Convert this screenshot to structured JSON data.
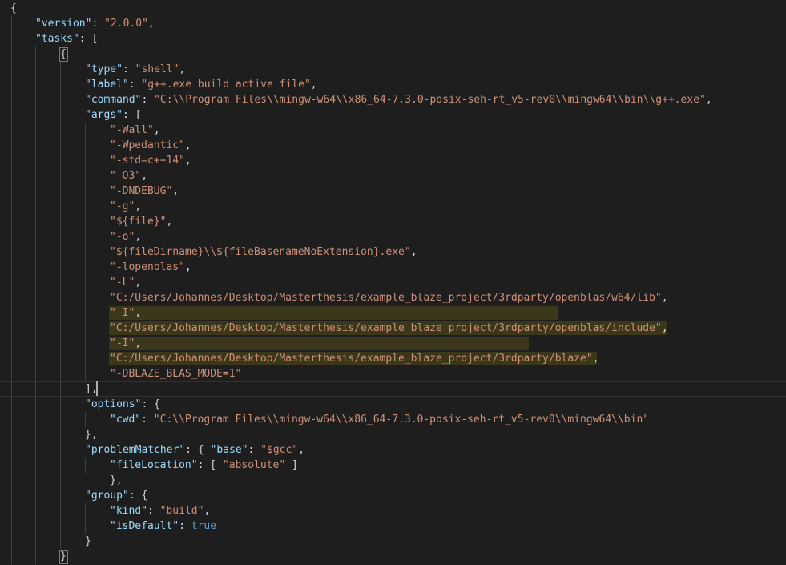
{
  "editor": {
    "language": "json",
    "file_lines": [
      [
        {
          "t": "p",
          "v": "{"
        }
      ],
      [
        {
          "t": "k",
          "v": "\"version\""
        },
        {
          "t": "p",
          "v": ": "
        },
        {
          "t": "s",
          "v": "\"2.0.0\""
        },
        {
          "t": "p",
          "v": ","
        }
      ],
      [
        {
          "t": "k",
          "v": "\"tasks\""
        },
        {
          "t": "p",
          "v": ": ["
        }
      ],
      [
        {
          "t": "p",
          "v": "{"
        }
      ],
      [
        {
          "t": "k",
          "v": "\"type\""
        },
        {
          "t": "p",
          "v": ": "
        },
        {
          "t": "s",
          "v": "\"shell\""
        },
        {
          "t": "p",
          "v": ","
        }
      ],
      [
        {
          "t": "k",
          "v": "\"label\""
        },
        {
          "t": "p",
          "v": ": "
        },
        {
          "t": "s",
          "v": "\"g++.exe build active file\""
        },
        {
          "t": "p",
          "v": ","
        }
      ],
      [
        {
          "t": "k",
          "v": "\"command\""
        },
        {
          "t": "p",
          "v": ": "
        },
        {
          "t": "s",
          "v": "\"C:\\\\Program Files\\\\mingw-w64\\\\x86_64-7.3.0-posix-seh-rt_v5-rev0\\\\mingw64\\\\bin\\\\g++.exe\""
        },
        {
          "t": "p",
          "v": ","
        }
      ],
      [
        {
          "t": "k",
          "v": "\"args\""
        },
        {
          "t": "p",
          "v": ": ["
        }
      ],
      [
        {
          "t": "s",
          "v": "\"-Wall\""
        },
        {
          "t": "p",
          "v": ","
        }
      ],
      [
        {
          "t": "s",
          "v": "\"-Wpedantic\""
        },
        {
          "t": "p",
          "v": ","
        }
      ],
      [
        {
          "t": "s",
          "v": "\"-std=c++14\""
        },
        {
          "t": "p",
          "v": ","
        }
      ],
      [
        {
          "t": "s",
          "v": "\"-O3\""
        },
        {
          "t": "p",
          "v": ","
        }
      ],
      [
        {
          "t": "s",
          "v": "\"-DNDEBUG\""
        },
        {
          "t": "p",
          "v": ","
        }
      ],
      [
        {
          "t": "s",
          "v": "\"-g\""
        },
        {
          "t": "p",
          "v": ","
        }
      ],
      [
        {
          "t": "s",
          "v": "\"${file}\""
        },
        {
          "t": "p",
          "v": ","
        }
      ],
      [
        {
          "t": "s",
          "v": "\"-o\""
        },
        {
          "t": "p",
          "v": ","
        }
      ],
      [
        {
          "t": "s",
          "v": "\"${fileDirname}\\\\${fileBasenameNoExtension}.exe\""
        },
        {
          "t": "p",
          "v": ","
        }
      ],
      [
        {
          "t": "s",
          "v": "\"-lopenblas\""
        },
        {
          "t": "p",
          "v": ","
        }
      ],
      [
        {
          "t": "s",
          "v": "\"-L\""
        },
        {
          "t": "p",
          "v": ","
        }
      ],
      [
        {
          "t": "s",
          "v": "\"C:/Users/Johannes/Desktop/Masterthesis/example_blaze_project/3rdparty/openblas/w64/lib\""
        },
        {
          "t": "p",
          "v": ","
        }
      ],
      [
        {
          "t": "s",
          "v": "\"-I\""
        },
        {
          "t": "p",
          "v": ","
        }
      ],
      [
        {
          "t": "s",
          "v": "\"C:/Users/Johannes/Desktop/Masterthesis/example_blaze_project/3rdparty/openblas/include\""
        },
        {
          "t": "p",
          "v": ","
        }
      ],
      [
        {
          "t": "s",
          "v": "\"-I\""
        },
        {
          "t": "p",
          "v": ","
        }
      ],
      [
        {
          "t": "s",
          "v": "\"C:/Users/Johannes/Desktop/Masterthesis/example_blaze_project/3rdparty/blaze\""
        },
        {
          "t": "p",
          "v": ","
        }
      ],
      [
        {
          "t": "s",
          "v": "\"-DBLAZE_BLAS_MODE=1\""
        }
      ],
      [
        {
          "t": "p",
          "v": "],"
        }
      ],
      [
        {
          "t": "k",
          "v": "\"options\""
        },
        {
          "t": "p",
          "v": ": {"
        }
      ],
      [
        {
          "t": "k",
          "v": "\"cwd\""
        },
        {
          "t": "p",
          "v": ": "
        },
        {
          "t": "s",
          "v": "\"C:\\\\Program Files\\\\mingw-w64\\\\x86_64-7.3.0-posix-seh-rt_v5-rev0\\\\mingw64\\\\bin\""
        }
      ],
      [
        {
          "t": "p",
          "v": "},"
        }
      ],
      [
        {
          "t": "k",
          "v": "\"problemMatcher\""
        },
        {
          "t": "p",
          "v": ": { "
        },
        {
          "t": "k",
          "v": "\"base\""
        },
        {
          "t": "p",
          "v": ": "
        },
        {
          "t": "s",
          "v": "\"$gcc\""
        },
        {
          "t": "p",
          "v": ","
        }
      ],
      [
        {
          "t": "k",
          "v": "\"fileLocation\""
        },
        {
          "t": "p",
          "v": ": [ "
        },
        {
          "t": "s",
          "v": "\"absolute\""
        },
        {
          "t": "p",
          "v": " ]"
        }
      ],
      [
        {
          "t": "p",
          "v": "},"
        }
      ],
      [
        {
          "t": "k",
          "v": "\"group\""
        },
        {
          "t": "p",
          "v": ": {"
        }
      ],
      [
        {
          "t": "k",
          "v": "\"kind\""
        },
        {
          "t": "p",
          "v": ": "
        },
        {
          "t": "s",
          "v": "\"build\""
        },
        {
          "t": "p",
          "v": ","
        }
      ],
      [
        {
          "t": "k",
          "v": "\"isDefault\""
        },
        {
          "t": "p",
          "v": ": "
        },
        {
          "t": "b",
          "v": "true"
        }
      ],
      [
        {
          "t": "p",
          "v": "}"
        }
      ],
      [
        {
          "t": "p",
          "v": "}"
        }
      ]
    ]
  }
}
